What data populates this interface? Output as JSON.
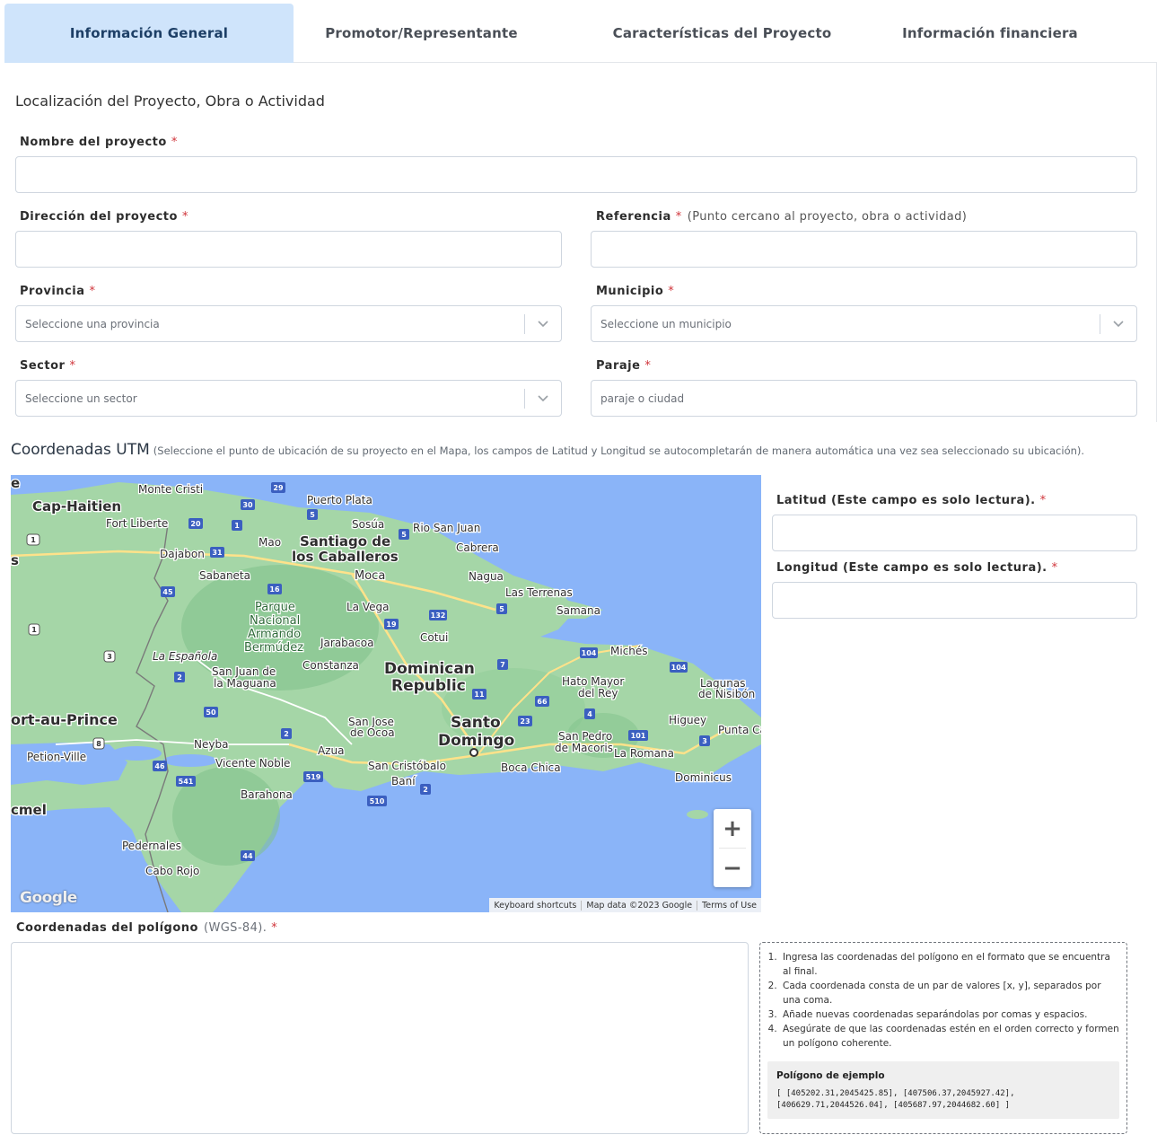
{
  "tabs": [
    {
      "label": "Información General",
      "active": true
    },
    {
      "label": "Promotor/Representante",
      "active": false
    },
    {
      "label": "Características del Proyecto",
      "active": false
    },
    {
      "label": "Información financiera",
      "active": false
    }
  ],
  "section_title": "Localización del Proyecto, Obra o Actividad",
  "required_mark": "*",
  "fields": {
    "nombre": {
      "label": "Nombre del proyecto",
      "value": ""
    },
    "direccion": {
      "label": "Dirección del proyecto",
      "value": ""
    },
    "referencia": {
      "label": "Referencia",
      "hint": "(Punto cercano al proyecto, obra o actividad)",
      "value": ""
    },
    "provincia": {
      "label": "Provincia",
      "placeholder": "Seleccione una provincia"
    },
    "municipio": {
      "label": "Municipio",
      "placeholder": "Seleccione un municipio"
    },
    "sector": {
      "label": "Sector",
      "placeholder": "Seleccione un sector"
    },
    "paraje": {
      "label": "Paraje",
      "placeholder": "paraje o ciudad"
    }
  },
  "utm": {
    "title": "Coordenadas UTM",
    "note": "(Seleccione el punto de ubicación de su proyecto en el Mapa, los campos de Latitud y Longitud se autocompletarán de manera automática una vez sea seleccionado su ubicación)."
  },
  "latitud": {
    "label": "Latitud (Este campo es solo lectura).",
    "value": ""
  },
  "longitud": {
    "label": "Longitud (Este campo es solo lectura).",
    "value": ""
  },
  "map": {
    "cities": [
      "Monte Cristi",
      "Cap-Haitien",
      "Fort Liberte",
      "Puerto Plata",
      "Sosúa",
      "Rio San Juan",
      "Mao",
      "Santiago de",
      "los Caballeros",
      "Cabrera",
      "Dajabon",
      "Sabaneta",
      "Moca",
      "Nagua",
      "Las Terrenas",
      "Samana",
      "Parque",
      "Nacional",
      "Armando",
      "Bermúdez",
      "La Vega",
      "Jarabacoa",
      "Cotui",
      "Michés",
      "Constanza",
      "La Española",
      "San Juan de",
      "la Maguana",
      "Dominican",
      "Republic",
      "Hato Mayor",
      "del Rey",
      "Lagunas",
      "de Nisibón",
      "ort-au-Prince",
      "San Jose",
      "de Ocoa",
      "Santo",
      "Domingo",
      "Higuey",
      "Punta Ca",
      "Neyba",
      "Azua",
      "San Pedro",
      "de Macoris",
      "La Romana",
      "Petion-Ville",
      "Vicente Noble",
      "San Cristóbalo",
      "Boca Chica",
      "Dominicus",
      "Baní",
      "Barahona",
      "cmel",
      "Pedernales",
      "Cabo Rojo",
      "s",
      "e"
    ],
    "highway_shields": [
      "29",
      "30",
      "5",
      "20",
      "1",
      "5",
      "1",
      "31",
      "45",
      "16",
      "19",
      "132",
      "5",
      "7",
      "104",
      "104",
      "11",
      "66",
      "4",
      "23",
      "101",
      "3",
      "50",
      "2",
      "2",
      "46",
      "541",
      "519",
      "510",
      "2",
      "44",
      "1",
      "3",
      "8",
      "7"
    ],
    "zoom_in": "+",
    "zoom_out": "−",
    "logo": "Google",
    "attribution": {
      "shortcuts": "Keyboard shortcuts",
      "data": "Map data ©2023 Google",
      "terms": "Terms of Use"
    }
  },
  "poligono": {
    "label": "Coordenadas del polígono",
    "hint": "(WGS-84).",
    "value": "",
    "instructions": [
      "Ingresa las coordenadas del polígono en el formato que se encuentra al final.",
      "Cada coordenada consta de un par de valores [x, y], separados por una coma.",
      "Añade nuevas coordenadas separándolas por comas y espacios.",
      "Asegúrate de que las coordenadas estén en el orden correcto y formen un polígono coherente."
    ],
    "example_title": "Polígono de ejemplo",
    "example_code": "[ [405202.31,2045425.85], [407506.37,2045927.42], [406629.71,2044526.04], [405687.97,2044682.60] ]"
  },
  "colors": {
    "tab_active_bg": "#cfe4fb",
    "required": "#d0343a",
    "map_water": "#8ab4f8",
    "map_land": "#9fd3a5"
  }
}
